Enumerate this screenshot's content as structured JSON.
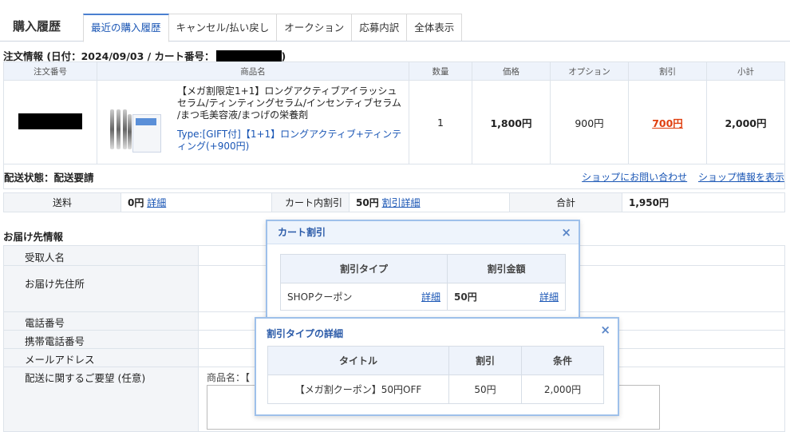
{
  "header": {
    "title": "購入履歴",
    "tabs": [
      "最近の購入履歴",
      "キャンセル/払い戻し",
      "オークション",
      "応募内訳",
      "全体表示"
    ]
  },
  "order_info": {
    "prefix": "注文情報 (日付：2024/09/03 / カート番号：",
    "suffix": ")"
  },
  "order_table": {
    "headers": [
      "注文番号",
      "商品名",
      "数量",
      "価格",
      "オプション",
      "割引",
      "小計"
    ],
    "product_name": "【メガ割限定1+1】ロングアクティブアイラッシュセラム/ティンティングセラム/インセンティブセラム /まつ毛美容液/まつげの栄養剤",
    "product_type": "Type:[GIFT付]【1+1】ロングアクティブ+ティンティング(+900円)",
    "quantity": "1",
    "price": "1,800円",
    "option": "900円",
    "discount": "700円",
    "subtotal": "2,000円",
    "shipping_status": "配送状態：配送要請",
    "contact_shop": "ショップにお問い合わせ",
    "shop_info": "ショップ情報を表示"
  },
  "totals": {
    "shipping_label": "送料",
    "shipping_value": "0円",
    "shipping_detail": "詳細",
    "cart_discount_label": "カート内割引",
    "cart_discount_value": "50円",
    "cart_discount_detail": "割引詳細",
    "total_label": "合計",
    "total_value": "1,950円"
  },
  "delivery": {
    "title": "お届け先情報",
    "fields": [
      "受取人名",
      "お届け先住所",
      "電話番号",
      "携帯電話番号",
      "メールアドレス",
      "配送に関するご要望 (任意)"
    ],
    "request_prefix": "商品名：【"
  },
  "popup_cart": {
    "title": "カート割引",
    "close": "×",
    "headers": [
      "割引タイプ",
      "割引金額"
    ],
    "type": "SHOPクーポン",
    "type_detail": "詳細",
    "amount": "50円",
    "amount_detail": "詳細"
  },
  "popup_detail": {
    "title": "割引タイプの詳細",
    "close": "×",
    "headers": [
      "タイトル",
      "割引",
      "条件"
    ],
    "row": [
      "【メガ割クーポン】50円OFF",
      "50円",
      "2,000円"
    ]
  },
  "colors": {
    "link": "#1a56b5",
    "discount": "#e04010",
    "popup_border": "#9ec0ea",
    "header_bg": "#eef3fb"
  }
}
